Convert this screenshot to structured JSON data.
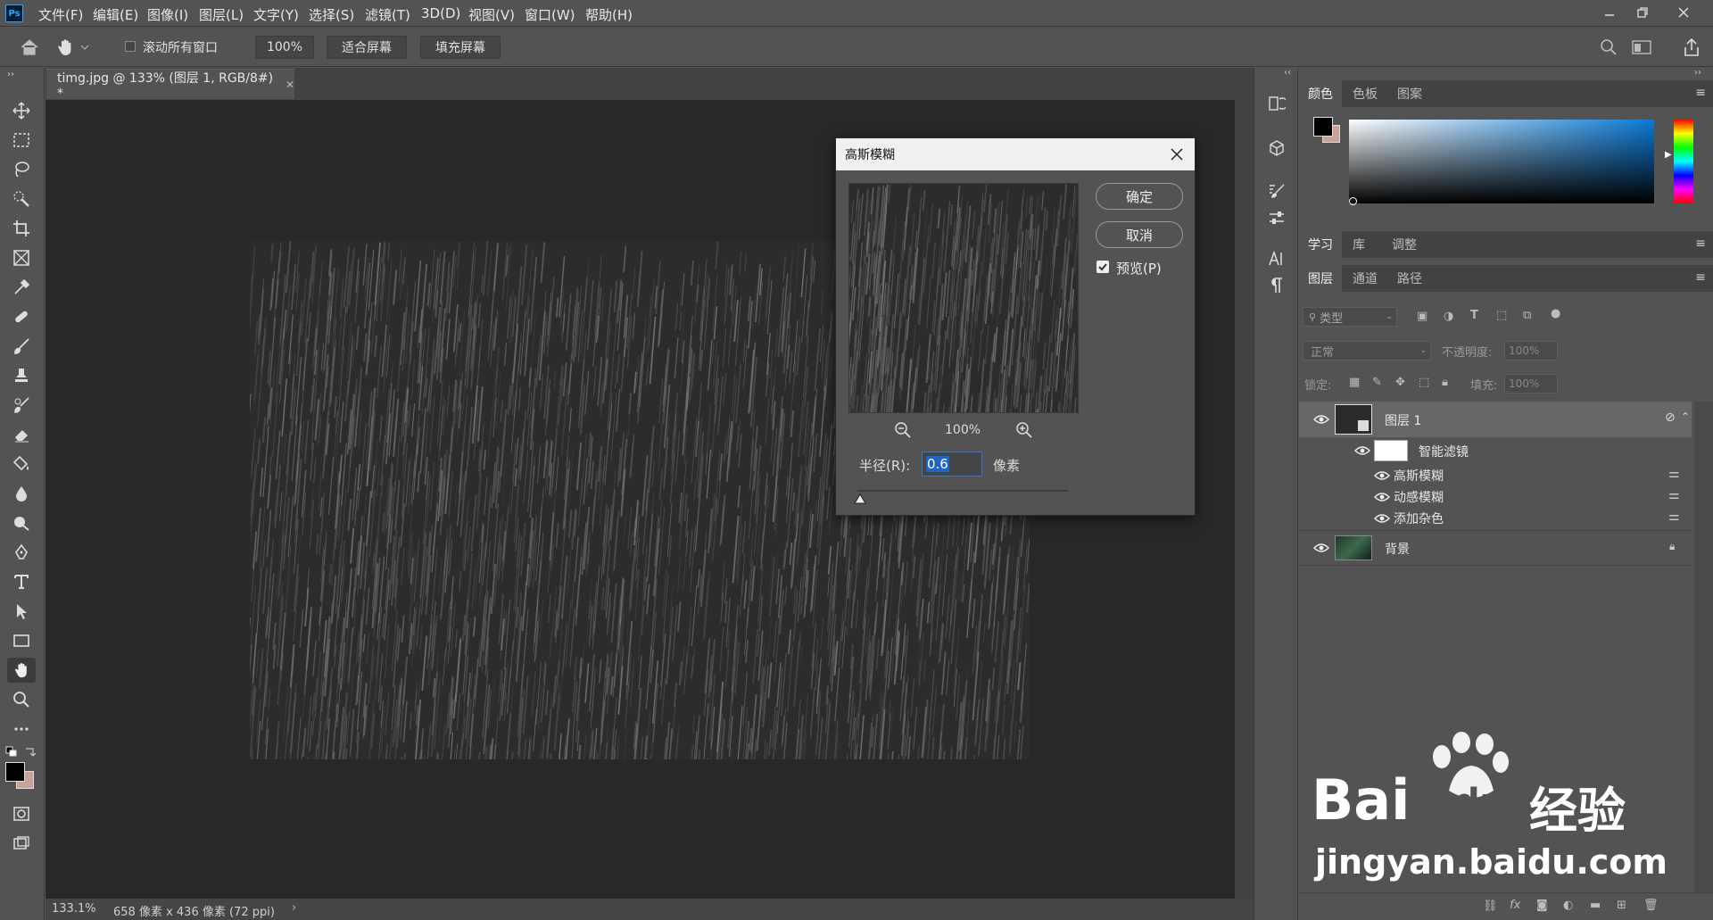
{
  "app": {
    "logo": "Ps"
  },
  "menu": [
    "文件(F)",
    "编辑(E)",
    "图像(I)",
    "图层(L)",
    "文字(Y)",
    "选择(S)",
    "滤镜(T)",
    "3D(D)",
    "视图(V)",
    "窗口(W)",
    "帮助(H)"
  ],
  "options": {
    "scroll_all_label": "滚动所有窗口",
    "zoom_value": "100%",
    "fit_screen": "适合屏幕",
    "fill_screen": "填充屏幕"
  },
  "document": {
    "tab_title": "timg.jpg @ 133% (图层 1, RGB/8#) *",
    "zoom": "133.1%",
    "info": "658 像素 x 436 像素 (72 ppi)"
  },
  "dialog": {
    "title": "高斯模糊",
    "ok_label": "确定",
    "cancel_label": "取消",
    "preview_label": "预览(P)",
    "preview_checked": true,
    "zoom_label": "100%",
    "radius_label": "半径(R):",
    "radius_value": "0.6",
    "unit_label": "像素"
  },
  "color_panel": {
    "tabs": [
      "颜色",
      "色板",
      "图案"
    ],
    "fg_color": "#000000",
    "bg_color": "#c9a39a"
  },
  "learn_panel": {
    "tabs": [
      "学习",
      "库",
      "调整"
    ]
  },
  "layers_panel": {
    "tabs": [
      "图层",
      "通道",
      "路径"
    ],
    "filter_kind": "类型",
    "blend_mode": "正常",
    "opacity_label": "不透明度:",
    "opacity_value": "100%",
    "lock_label": "锁定:",
    "fill_label": "填充:",
    "fill_value": "100%",
    "layers": [
      {
        "name": "图层 1"
      },
      {
        "name": "智能滤镜"
      },
      {
        "name": "高斯模糊"
      },
      {
        "name": "动感模糊"
      },
      {
        "name": "添加杂色"
      },
      {
        "name": "背景"
      }
    ]
  },
  "watermark": {
    "brand": "Bai",
    "brand2": "du",
    "cn": "经验",
    "url": "jingyan.baidu.com"
  }
}
